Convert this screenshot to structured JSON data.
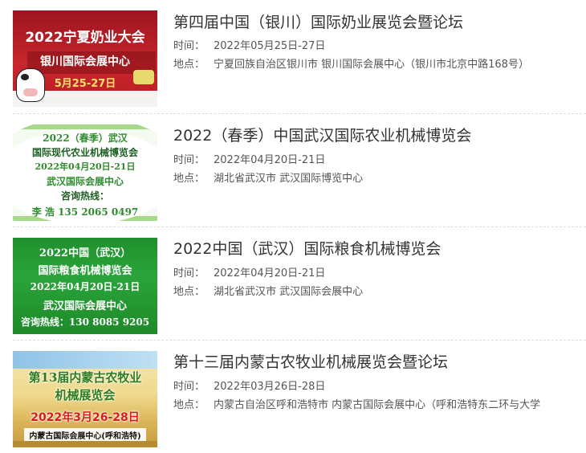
{
  "labels": {
    "time": "时间：",
    "place": "地点："
  },
  "events": [
    {
      "title": "第四届中国（银川）国际奶业展览会暨论坛",
      "time": "2022年05月25日-27日",
      "place": "宁夏回族自治区银川市 银川国际会展中心（银川市北京中路168号）",
      "poster": {
        "line1": "2022宁夏奶业大会",
        "line2": "银川国际会展中心",
        "line3": "5月25-27日"
      }
    },
    {
      "title": "2022（春季）中国武汉国际农业机械博览会",
      "time": "2022年04月20日-21日",
      "place": "湖北省武汉市 武汉国际博览中心",
      "poster": {
        "line1": "2022（春季）武汉",
        "line2": "国际现代农业机械博览会",
        "line3": "2022年04月20日-21日",
        "line4": "武汉国际会展中心",
        "line5": "咨询热线：",
        "line6": "李 浩 135 2065 0497"
      }
    },
    {
      "title": "2022中国（武汉）国际粮食机械博览会",
      "time": "2022年04月20日-21日",
      "place": "湖北省武汉市 武汉国际会展中心",
      "poster": {
        "line1": "2022中国（武汉）",
        "line2": "国际粮食机械博览会",
        "line3": "2022年04月20日-21日",
        "line4": "武汉国际会展中心",
        "line5": "咨询热线：130 8085 9205"
      }
    },
    {
      "title": "第十三届内蒙古农牧业机械展览会暨论坛",
      "time": "2022年03月26日-28日",
      "place": "内蒙古自治区呼和浩特市 内蒙古国际会展中心（呼和浩特东二环与大学",
      "poster": {
        "line1": "第13届内蒙古农牧业",
        "line2": "机械展览会",
        "line3": "2022年3月26-28日",
        "line4": "内蒙古国际会展中心(呼和浩特)"
      }
    }
  ]
}
